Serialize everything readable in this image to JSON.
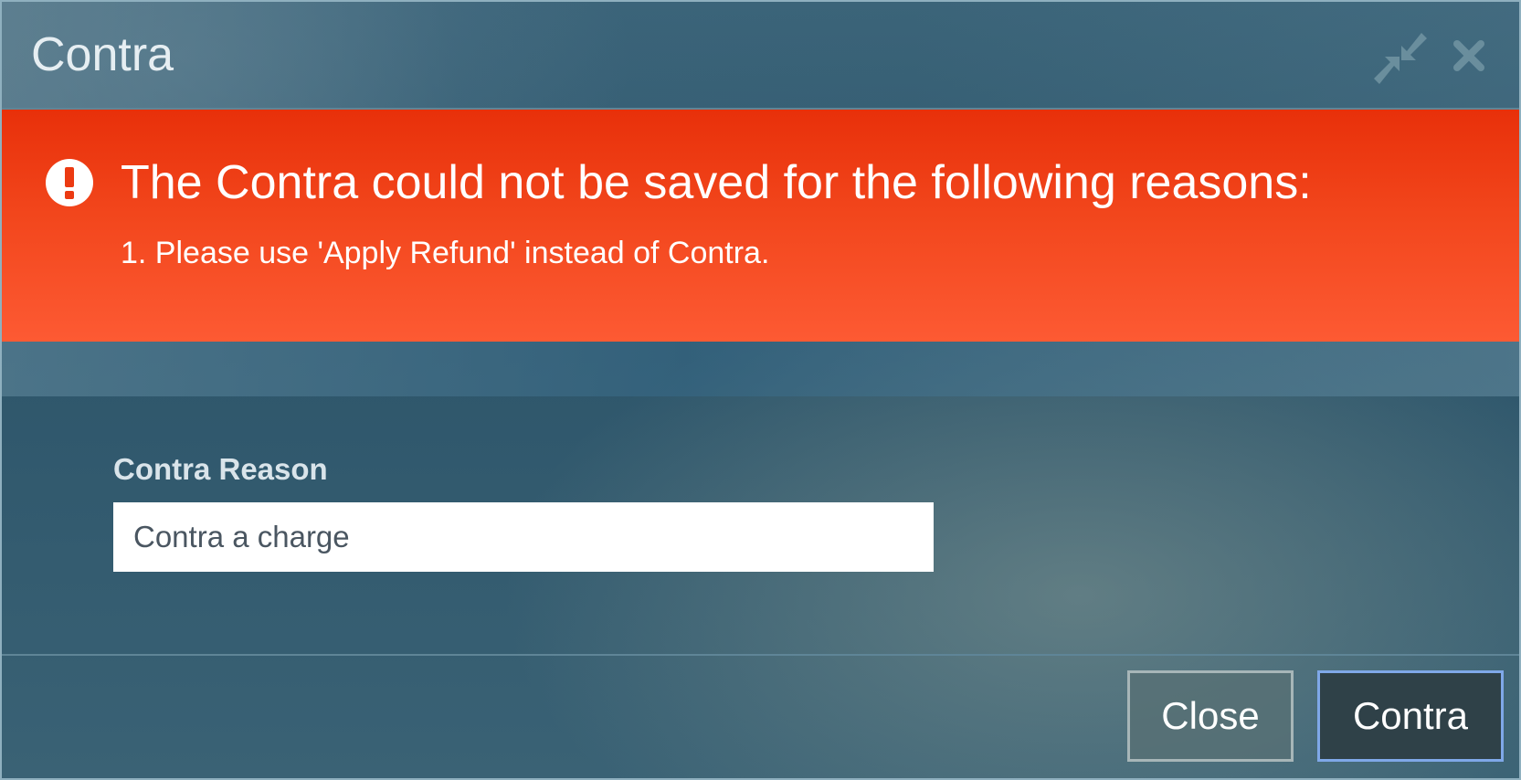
{
  "dialog": {
    "title": "Contra",
    "collapse_icon": "collapse-arrows-icon",
    "close_icon": "close-x-icon"
  },
  "error": {
    "icon": "exclamation-circle-icon",
    "heading": "The Contra could not be saved for the following reasons:",
    "reasons": [
      "1. Please use 'Apply Refund' instead of Contra."
    ],
    "color": "#e8300a"
  },
  "form": {
    "reason_label": "Contra Reason",
    "reason_value": "Contra a charge"
  },
  "footer": {
    "close_label": "Close",
    "contra_label": "Contra"
  }
}
